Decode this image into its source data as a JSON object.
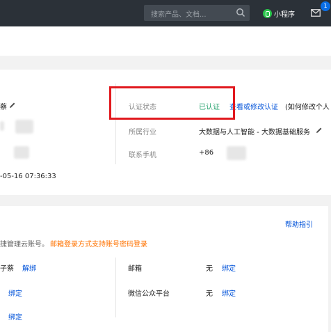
{
  "topbar": {
    "search_placeholder": "搜索产品、文档...",
    "mini_program_label": "小程序",
    "mail_badge": "1"
  },
  "profile": {
    "name_fragment": "蔡",
    "time_fragment": "-05-16 07:36:33",
    "auth_status_label": "认证状态",
    "auth_status_value": "已认证",
    "auth_link": "查看或修改认证",
    "auth_hint": "(如何修改个人",
    "industry_label": "所属行业",
    "industry_value": "大数据与人工智能 - 大数据基础服务",
    "phone_label": "联系手机",
    "phone_value": "+86"
  },
  "accounts": {
    "help_link": "帮助指引",
    "intro_text": "捷管理云账号。",
    "intro_warning": "邮箱登录方式支持账号密码登录",
    "row1_name": "子蔡",
    "row1_action": "解绑",
    "row2_action": "绑定",
    "row3_action": "绑定",
    "email_label": "邮箱",
    "email_value": "无",
    "email_action": "绑定",
    "wechat_label": "微信公众平台",
    "wechat_value": "无",
    "wechat_action": "绑定"
  },
  "colors": {
    "topbar": "#2b3138",
    "success": "#2ba471",
    "link": "#0052d9",
    "warning": "#ff7200",
    "highlight": "#e1191e"
  }
}
